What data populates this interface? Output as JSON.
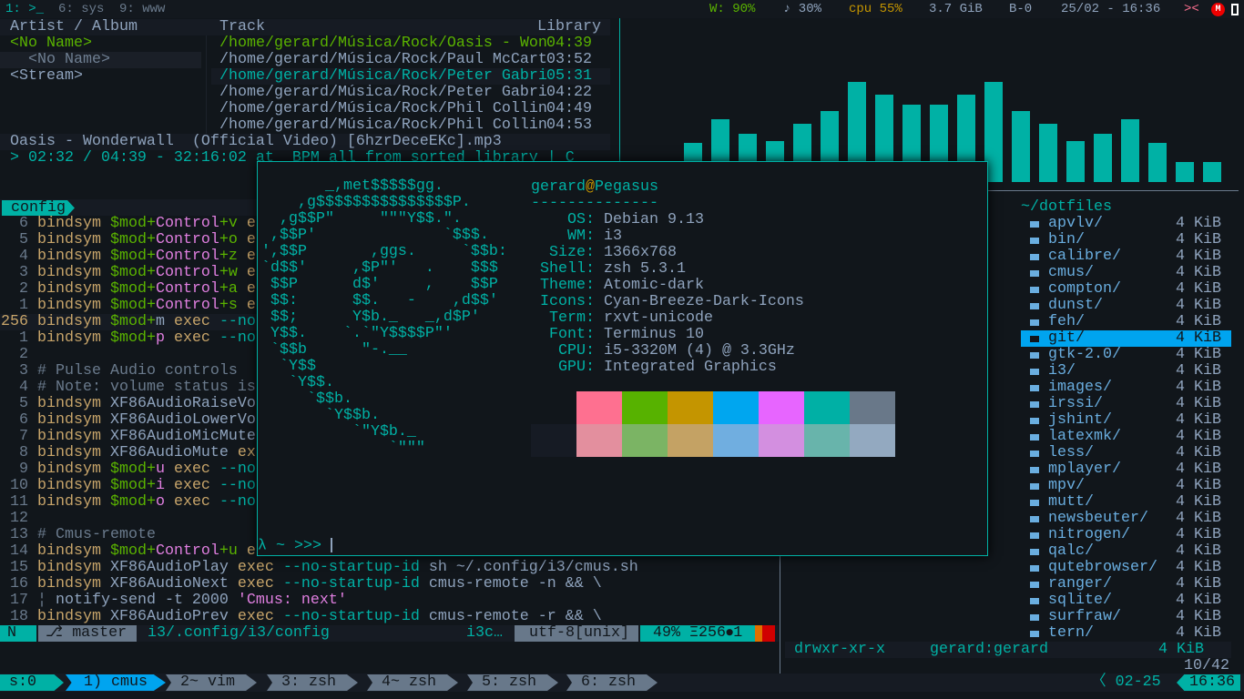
{
  "topbar": {
    "workspaces": [
      "1: >_",
      "6: sys",
      "9: www"
    ],
    "wifi": "W: 90%",
    "volume": "♪ 30%",
    "cpu": "cpu 55%",
    "mem": "3.7 GiB",
    "battery": "B-0",
    "datetime": "25/02 - 16:36",
    "arrows": "><",
    "icons": [
      "mega-icon",
      "usb-icon"
    ]
  },
  "cmus": {
    "header": {
      "artist": "Artist / Album",
      "track": "Track",
      "library": "Library"
    },
    "artists": [
      "<No Name>",
      "<No Name>",
      "<Stream>"
    ],
    "tracks": [
      {
        "path": "/home/gerard/Música/Rock/Oasis - Won",
        "dur": "04:39"
      },
      {
        "path": "/home/gerard/Música/Rock/Paul McCart",
        "dur": "03:52"
      },
      {
        "path": "/home/gerard/Música/Rock/Peter Gabri",
        "dur": "05:31"
      },
      {
        "path": "/home/gerard/Música/Rock/Peter Gabri",
        "dur": "04:22"
      },
      {
        "path": "/home/gerard/Música/Rock/Phil Collin",
        "dur": "04:49"
      },
      {
        "path": "/home/gerard/Música/Rock/Phil Collin",
        "dur": "04:53"
      }
    ],
    "now_playing": "Oasis - Wonderwall  (Official Video) [6hzrDeceEKc].mp3",
    "status": "> 02:32 / 04:39 - 32:16:02 at  BPM all from sorted library | C"
  },
  "visualizer": {
    "levels": [
      39,
      63,
      48,
      41,
      58,
      71,
      100,
      87,
      77,
      77,
      87,
      100,
      71,
      58,
      41,
      48,
      63,
      39,
      20,
      20
    ],
    "color": "#00b1a5"
  },
  "vim": {
    "tab": "config",
    "lines": [
      {
        "n": "6",
        "s": [
          [
            "bindsym ",
            "kw"
          ],
          [
            "$mod+",
            "green"
          ],
          [
            "Control",
            "pink"
          ],
          [
            "+v",
            "green"
          ],
          [
            " e",
            "kw"
          ]
        ]
      },
      {
        "n": "5",
        "s": [
          [
            "bindsym ",
            "kw"
          ],
          [
            "$mod+",
            "green"
          ],
          [
            "Control",
            "pink"
          ],
          [
            "+o",
            "green"
          ],
          [
            " e",
            "kw"
          ]
        ]
      },
      {
        "n": "4",
        "s": [
          [
            "bindsym ",
            "kw"
          ],
          [
            "$mod+",
            "green"
          ],
          [
            "Control",
            "pink"
          ],
          [
            "+z",
            "green"
          ],
          [
            " e",
            "kw"
          ]
        ]
      },
      {
        "n": "3",
        "s": [
          [
            "bindsym ",
            "kw"
          ],
          [
            "$mod+",
            "green"
          ],
          [
            "Control",
            "pink"
          ],
          [
            "+w",
            "green"
          ],
          [
            " e",
            "kw"
          ]
        ]
      },
      {
        "n": "2",
        "s": [
          [
            "bindsym ",
            "kw"
          ],
          [
            "$mod+",
            "green"
          ],
          [
            "Control",
            "pink"
          ],
          [
            "+a",
            "green"
          ],
          [
            " e",
            "kw"
          ]
        ]
      },
      {
        "n": "1",
        "s": [
          [
            "bindsym ",
            "kw"
          ],
          [
            "$mod+",
            "green"
          ],
          [
            "Control",
            "pink"
          ],
          [
            "+s",
            "green"
          ],
          [
            " e",
            "kw"
          ]
        ]
      },
      {
        "n": "256",
        "cur": true,
        "s": [
          [
            "bindsym ",
            "kw"
          ],
          [
            "$mod+",
            "green"
          ],
          [
            "m",
            "gray"
          ],
          [
            " exec ",
            "kw"
          ],
          [
            "--no",
            "teal"
          ]
        ]
      },
      {
        "n": "1",
        "s": [
          [
            "bindsym ",
            "kw"
          ],
          [
            "$mod+",
            "green"
          ],
          [
            "p",
            "pink"
          ],
          [
            " exec ",
            "kw"
          ],
          [
            "--no",
            "teal"
          ]
        ]
      },
      {
        "n": "2",
        "s": []
      },
      {
        "n": "3",
        "s": [
          [
            "# Pulse Audio controls",
            "dim"
          ]
        ]
      },
      {
        "n": "4",
        "s": [
          [
            "# Note: volume status is",
            "dim"
          ]
        ]
      },
      {
        "n": "5",
        "s": [
          [
            "bindsym ",
            "kw"
          ],
          [
            "XF86AudioRaiseVo",
            "gray"
          ]
        ]
      },
      {
        "n": "6",
        "s": [
          [
            "bindsym ",
            "kw"
          ],
          [
            "XF86AudioLowerVo",
            "gray"
          ]
        ]
      },
      {
        "n": "7",
        "s": [
          [
            "bindsym ",
            "kw"
          ],
          [
            "XF86AudioMicMute",
            "gray"
          ]
        ]
      },
      {
        "n": "8",
        "s": [
          [
            "bindsym ",
            "kw"
          ],
          [
            "XF86AudioMute ",
            "gray"
          ],
          [
            "ex",
            "kw"
          ]
        ]
      },
      {
        "n": "9",
        "s": [
          [
            "bindsym ",
            "kw"
          ],
          [
            "$mod+",
            "green"
          ],
          [
            "u",
            "pink"
          ],
          [
            " exec ",
            "kw"
          ],
          [
            "--no",
            "teal"
          ]
        ]
      },
      {
        "n": "10",
        "s": [
          [
            "bindsym ",
            "kw"
          ],
          [
            "$mod+",
            "green"
          ],
          [
            "i",
            "pink"
          ],
          [
            " exec ",
            "kw"
          ],
          [
            "--no",
            "teal"
          ]
        ]
      },
      {
        "n": "11",
        "s": [
          [
            "bindsym ",
            "kw"
          ],
          [
            "$mod+",
            "green"
          ],
          [
            "o",
            "pink"
          ],
          [
            " exec ",
            "kw"
          ],
          [
            "--no",
            "teal"
          ]
        ]
      },
      {
        "n": "12",
        "s": []
      },
      {
        "n": "13",
        "s": [
          [
            "# Cmus-remote",
            "dim"
          ]
        ]
      },
      {
        "n": "14",
        "s": [
          [
            "bindsym ",
            "kw"
          ],
          [
            "$mod+",
            "green"
          ],
          [
            "Control",
            "pink"
          ],
          [
            "+u",
            "green"
          ],
          [
            " e",
            "kw"
          ]
        ]
      },
      {
        "n": "15",
        "s": [
          [
            "bindsym ",
            "kw"
          ],
          [
            "XF86AudioPlay ",
            "gray"
          ],
          [
            "exec ",
            "kw"
          ],
          [
            "--no-startup-id ",
            "teal"
          ],
          [
            "sh ~/.config/i3/cmus.sh",
            "gray"
          ]
        ]
      },
      {
        "n": "16",
        "s": [
          [
            "bindsym ",
            "kw"
          ],
          [
            "XF86AudioNext ",
            "gray"
          ],
          [
            "exec ",
            "kw"
          ],
          [
            "--no-startup-id ",
            "teal"
          ],
          [
            "cmus-remote -n && \\",
            "gray"
          ]
        ]
      },
      {
        "n": "17",
        "s": [
          [
            "¦ ",
            "dim"
          ],
          [
            "notify-send -t 2000 ",
            "gray"
          ],
          [
            "'Cmus: next'",
            "pink"
          ]
        ]
      },
      {
        "n": "18",
        "s": [
          [
            "bindsym ",
            "kw"
          ],
          [
            "XF86AudioPrev ",
            "gray"
          ],
          [
            "exec ",
            "kw"
          ],
          [
            "--no-startup-id ",
            "teal"
          ],
          [
            "cmus-remote -r && \\",
            "gray"
          ]
        ]
      }
    ],
    "status": {
      "mode": "N",
      "branch": "⎇ master",
      "file": "i3/.config/i3/config",
      "ft": "i3c…",
      "enc": "utf-8[unix]",
      "pos": "49% Ξ256⦁1"
    }
  },
  "neofetch": {
    "user": "gerard",
    "at": "@",
    "host": "Pegasus",
    "rule": "--------------",
    "ascii": "       _,met$$$$$gg.\n    ,g$$$$$$$$$$$$$$$P.\n  ,g$$P\"     \"\"\"Y$$.\".\n ,$$P'              `$$$.\n',$$P       ,ggs.     `$$b:\n`d$$'     ,$P\"'   .    $$$\n $$P      d$'     ,    $$P\n $$:      $$.   -    ,d$$'\n $$;      Y$b._   _,d$P'\n Y$$.    `.`\"Y$$$$P\"'\n `$$b      \"-.__\n  `Y$$\n   `Y$$.\n     `$$b.\n       `Y$$b.\n          `\"Y$b._\n              `\"\"\"",
    "info": [
      [
        "OS",
        "Debian 9.13"
      ],
      [
        "WM",
        "i3"
      ],
      [
        "Size",
        "1366x768"
      ],
      [
        "Shell",
        "zsh 5.3.1"
      ],
      [
        "Theme",
        "Atomic-dark"
      ],
      [
        "Icons",
        "Cyan-Breeze-Dark-Icons"
      ],
      [
        "Term",
        "rxvt-unicode"
      ],
      [
        "Font",
        "Terminus 10"
      ],
      [
        "CPU",
        "i5-3320M (4) @ 3.3GHz"
      ],
      [
        "GPU",
        "Integrated Graphics"
      ]
    ],
    "palette_top": [
      "#fe7090",
      "#57b200",
      "#c49500",
      "#00a6ef",
      "#e765ff",
      "#00b0a5",
      "#697889"
    ],
    "palette_bottom": [
      "#161b24",
      "#e38f9e",
      "#7bb464",
      "#c4a264",
      "#70aee0",
      "#d38fe0",
      "#68b4ab",
      "#93a9c0"
    ],
    "prompt": "λ ~ >>> "
  },
  "ranger": {
    "path": "~/dotfiles",
    "selected": 7,
    "files": [
      "apvlv/",
      "bin/",
      "calibre/",
      "cmus/",
      "compton/",
      "dunst/",
      "feh/",
      "git/",
      "gtk-2.0/",
      "i3/",
      "images/",
      "irssi/",
      "jshint/",
      "latexmk/",
      "less/",
      "mplayer/",
      "mpv/",
      "mutt/",
      "newsbeuter/",
      "nitrogen/",
      "qalc/",
      "qutebrowser/",
      "ranger/",
      "sqlite/",
      "surfraw/",
      "tern/"
    ],
    "size": "4 KiB",
    "perms": "drwxr-xr-x",
    "owner": "gerard:gerard",
    "count": "10/42"
  },
  "tmux": {
    "session": "s:0",
    "windows": [
      "1) cmus",
      "2~ vim",
      "3: zsh",
      "4~ zsh",
      "5: zsh",
      "6: zsh"
    ],
    "active": 0,
    "date": "〈 02-25",
    "time": "16:36"
  }
}
